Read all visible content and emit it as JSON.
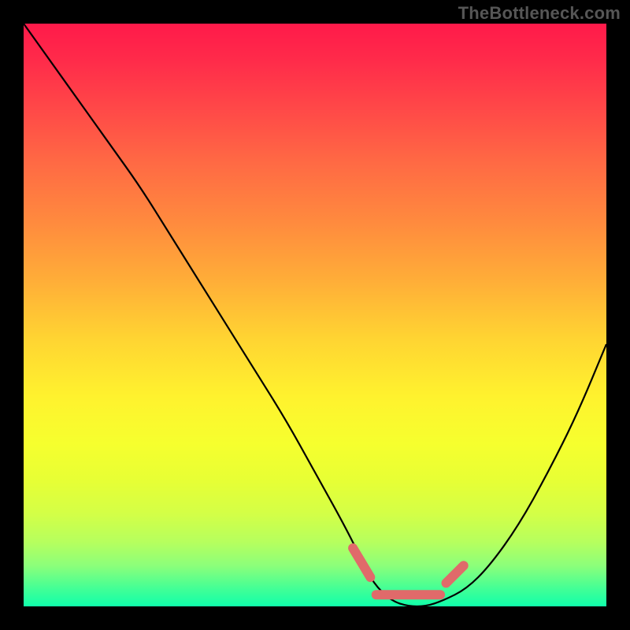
{
  "attribution": "TheBottleneck.com",
  "chart_data": {
    "type": "line",
    "title": "",
    "xlabel": "",
    "ylabel": "",
    "xlim": [
      0,
      100
    ],
    "ylim": [
      0,
      100
    ],
    "gradient_background": {
      "top_color": "#ff1a4a",
      "bottom_color": "#10ffaa",
      "note": "red (high bottleneck) to green (low bottleneck)"
    },
    "series": [
      {
        "name": "bottleneck-curve",
        "x": [
          0,
          5,
          10,
          15,
          20,
          25,
          30,
          35,
          40,
          45,
          50,
          55,
          58,
          60,
          63,
          66,
          69,
          72,
          76,
          80,
          85,
          90,
          95,
          100
        ],
        "y": [
          100,
          93,
          86,
          79,
          72,
          64,
          56,
          48,
          40,
          32,
          23,
          14,
          8,
          4,
          1,
          0,
          0,
          1,
          3,
          7,
          14,
          23,
          33,
          45
        ]
      }
    ],
    "markers": {
      "name": "optimal-range-marker",
      "color": "#e06a6a",
      "segments": [
        {
          "x": [
            56.5,
            59.5
          ],
          "y": [
            10,
            5
          ]
        },
        {
          "x": [
            60.5,
            71.5
          ],
          "y": [
            2.0,
            2.0
          ]
        },
        {
          "x": [
            72.5,
            75.5
          ],
          "y": [
            4,
            7
          ]
        }
      ]
    }
  }
}
